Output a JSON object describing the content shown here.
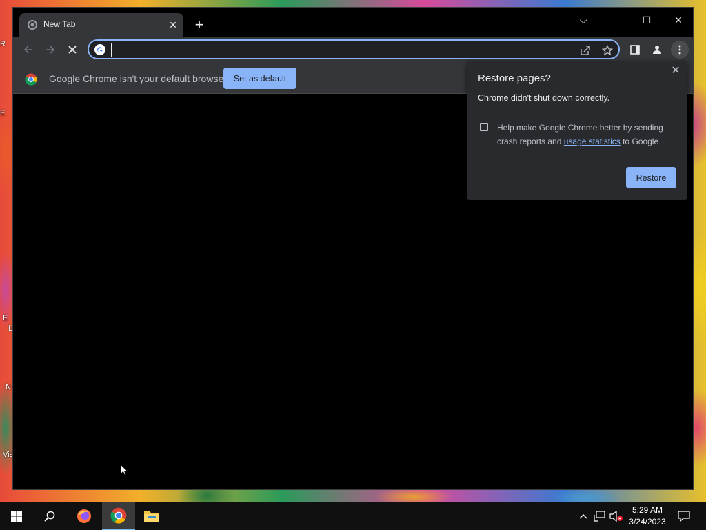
{
  "desktop": {
    "icon_labels": [
      "R",
      "E",
      "E",
      "D",
      "N",
      "Vis"
    ]
  },
  "browser": {
    "tab": {
      "title": "New Tab"
    },
    "window_controls": {
      "tab_search": "⌵",
      "minimize": "—",
      "maximize": "☐",
      "close": "✕"
    },
    "omnibox": {
      "value": "",
      "placeholder": ""
    },
    "infobar": {
      "message": "Google Chrome isn't your default browser",
      "button_label": "Set as default"
    }
  },
  "restore_popup": {
    "title": "Restore pages?",
    "message": "Chrome didn't shut down correctly.",
    "checkbox_text_1": "Help make Google Chrome better by sending crash reports and ",
    "checkbox_link": "usage statistics",
    "checkbox_text_2": " to Google",
    "checkbox_checked": false,
    "button_label": "Restore"
  },
  "taskbar": {
    "time": "5:29 AM",
    "date": "3/24/2023",
    "pinned": [
      "start-icon",
      "search-icon",
      "firefox-icon",
      "chrome-icon",
      "file-explorer-icon"
    ]
  },
  "colors": {
    "accent": "#8ab4f8",
    "toolbar_bg": "#35363a",
    "popup_bg": "#292a2d"
  }
}
